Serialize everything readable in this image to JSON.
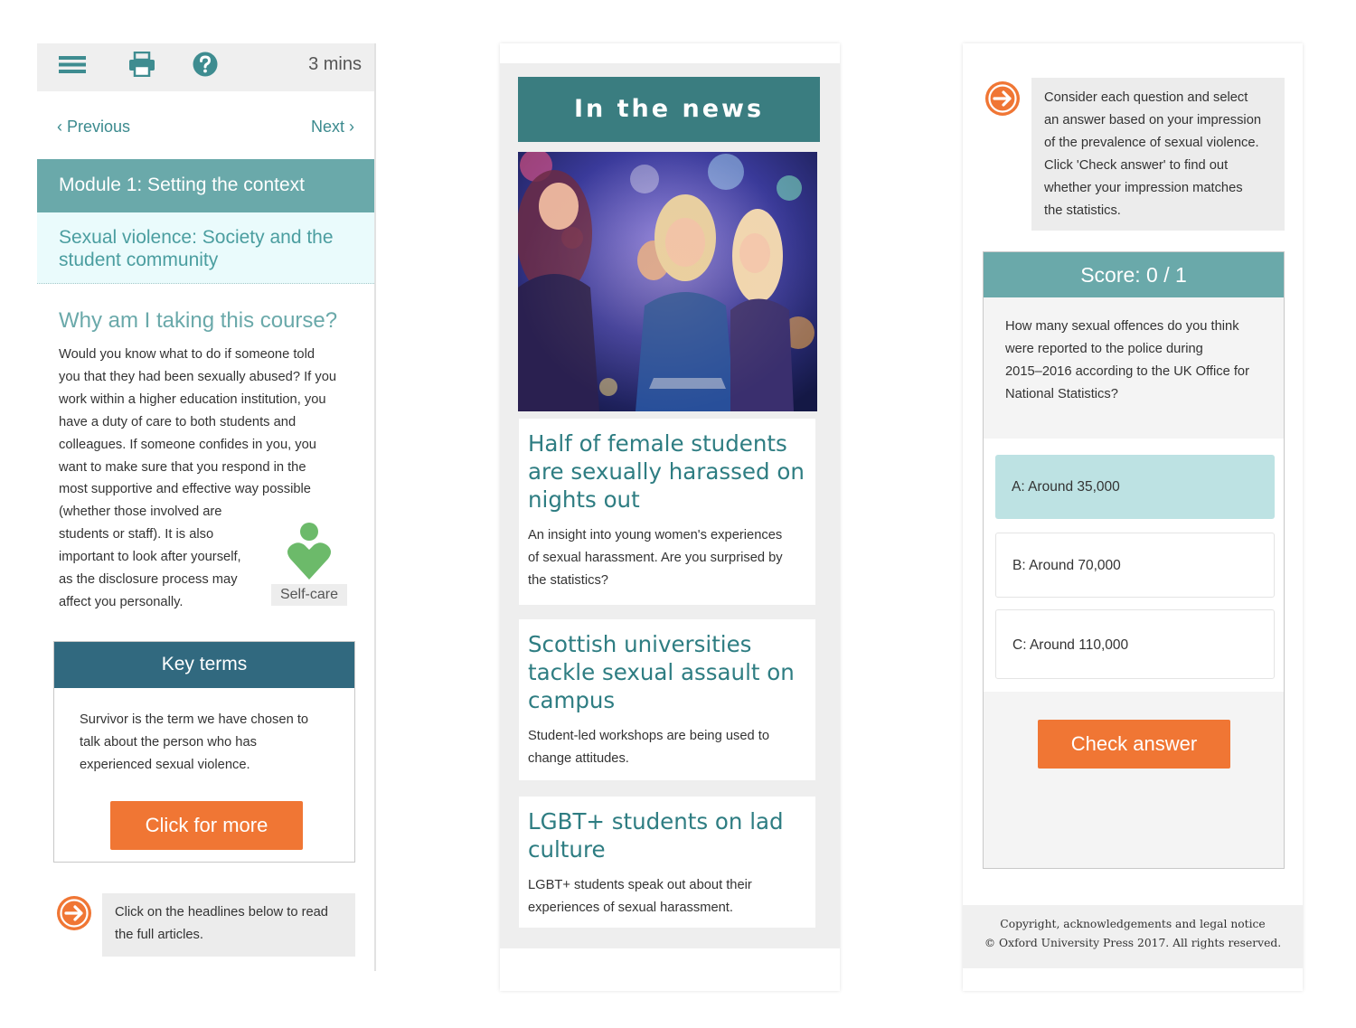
{
  "panel1": {
    "toolbar": {
      "menu_icon": "menu-icon",
      "print_icon": "print-icon",
      "help_icon": "help-icon",
      "duration": "3 mins"
    },
    "nav": {
      "previous": "Previous",
      "next": "Next"
    },
    "module_title": "Module 1: Setting the context",
    "subtitle": "Sexual violence: Society and the student community",
    "section_heading": "Why am I taking this course?",
    "body_lines": [
      "Would you know what to do if someone told",
      "you that they had been sexually abused? If you",
      "work within a higher education institution, you",
      "have a duty of care to both students and",
      "colleagues. If someone confides in you, you",
      "want to make sure that you respond in the",
      "most supportive and effective way possible",
      "(whether those involved are",
      "students or staff). It is also",
      "important to look after yourself,",
      "as the disclosure process may",
      "affect you personally."
    ],
    "selfcare_label": "Self-care",
    "key_terms": {
      "heading": "Key terms",
      "lines": [
        "Survivor is the term we have chosen to",
        "talk about the person who has",
        "experienced sexual violence."
      ],
      "button": "Click for more"
    },
    "tip_lines": [
      "Click on the headlines below to read",
      "the full articles."
    ]
  },
  "panel2": {
    "heading": "In the news",
    "articles": [
      {
        "headline_lines": [
          "Half of female students",
          "are sexually harassed on",
          "nights out"
        ],
        "summary_lines": [
          "An insight into young women's experiences",
          "of sexual harassment. Are you surprised by",
          "the statistics?"
        ]
      },
      {
        "headline_lines": [
          "Scottish universities",
          "tackle sexual assault on",
          "campus"
        ],
        "summary_lines": [
          "Student-led workshops are being used to",
          "change attitudes."
        ]
      },
      {
        "headline_lines": [
          "LGBT+ students on lad",
          "culture"
        ],
        "summary_lines": [
          "LGBT+ students speak out about their",
          "experiences of sexual harassment."
        ]
      }
    ]
  },
  "panel3": {
    "tip_lines": [
      "Consider each question and select",
      "an answer based on your impression",
      "of the prevalence of sexual violence.",
      "Click 'Check answer' to find out",
      "whether your impression matches",
      "the statistics."
    ],
    "score": "Score: 0 / 1",
    "question_lines": [
      "How many sexual offences do you think",
      "were reported to the police during",
      "2015–2016 according to the UK Office for",
      "National Statistics?"
    ],
    "answers": [
      "A: Around 35,000",
      "B: Around 70,000",
      "C: Around 110,000"
    ],
    "selected_answer": "A: Around 35,000",
    "check_button": "Check answer",
    "footer": {
      "line1": "Copyright, acknowledgements and legal notice",
      "line2": "© Oxford University Press 2017. All rights reserved."
    }
  },
  "colors": {
    "teal": "#6aa9aa",
    "dark_teal": "#3a7d80",
    "key_terms_blue": "#31697f",
    "orange": "#f07634",
    "selected_answer_bg": "#bde2e3",
    "selfcare_green": "#6cba6a"
  }
}
